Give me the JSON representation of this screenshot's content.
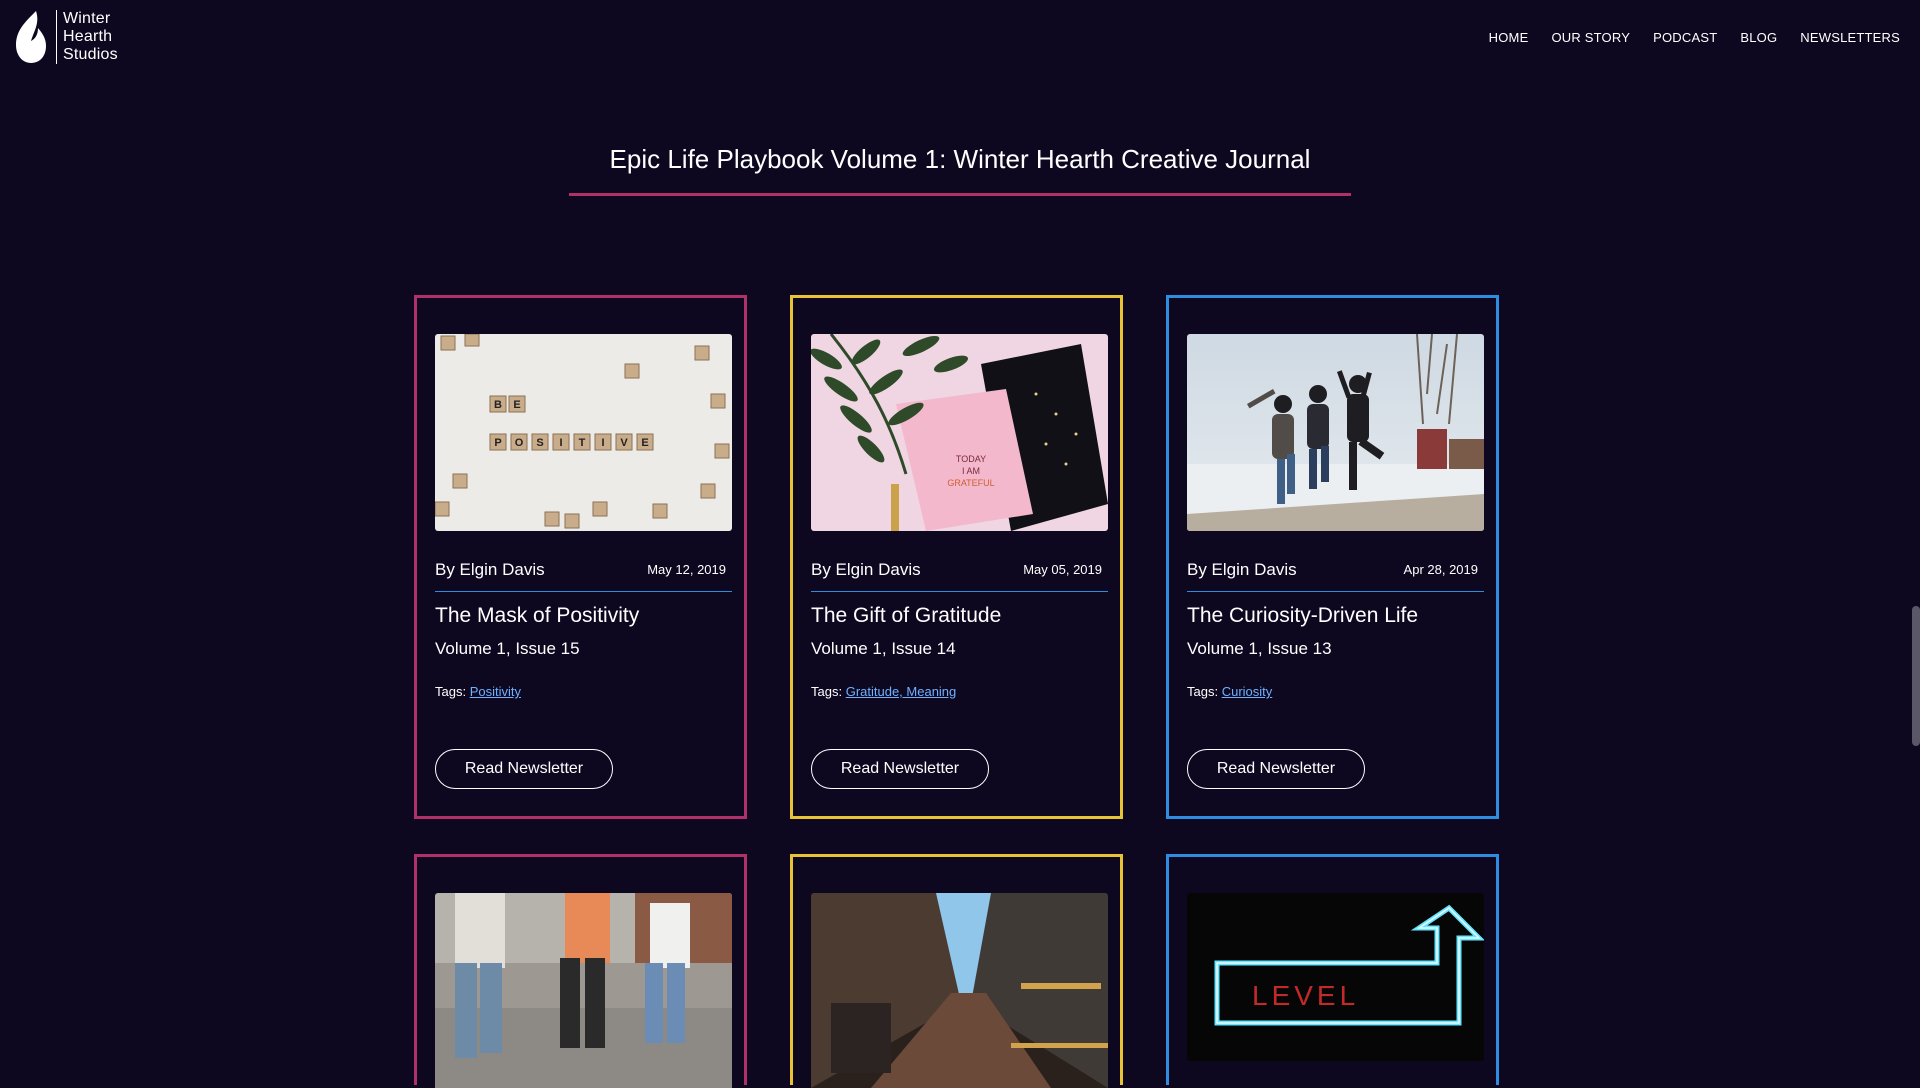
{
  "brand": {
    "line1": "Winter",
    "line2": "Hearth",
    "line3": "Studios"
  },
  "nav": [
    "HOME",
    "OUR STORY",
    "PODCAST",
    "BLOG",
    "NEWSLETTERS"
  ],
  "page_title": "Epic Life Playbook Volume 1: Winter Hearth Creative Journal",
  "colors": {
    "background": "#0d0820",
    "pink": "#b03069",
    "yellow": "#e9c336",
    "blue": "#2f8de1",
    "link": "#6fb0ff"
  },
  "cards": [
    {
      "author": "By Elgin Davis",
      "date": "May 12, 2019",
      "title": "The Mask of Positivity",
      "issue": "Volume 1, Issue 15",
      "tags_label": "Tags:",
      "tags": "Positivity",
      "button": "Read Newsletter",
      "image": "scrabble-tiles-be-positive"
    },
    {
      "author": "By Elgin Davis",
      "date": "May 05, 2019",
      "title": "The Gift of Gratitude",
      "issue": "Volume 1, Issue 14",
      "tags_label": "Tags:",
      "tags": "Gratitude, Meaning",
      "button": "Read Newsletter",
      "image": "gratitude-notebook-with-fern"
    },
    {
      "author": "By Elgin Davis",
      "date": "Apr 28, 2019",
      "title": "The Curiosity-Driven Life",
      "issue": "Volume 1, Issue 13",
      "tags_label": "Tags:",
      "tags": "Curiosity",
      "button": "Read Newsletter",
      "image": "friends-jumping-in-snow"
    },
    {
      "image": "people-sitting-on-wall"
    },
    {
      "image": "narrow-city-street"
    },
    {
      "image": "neon-level-up-sign",
      "image_text": "LEVEL"
    }
  ]
}
